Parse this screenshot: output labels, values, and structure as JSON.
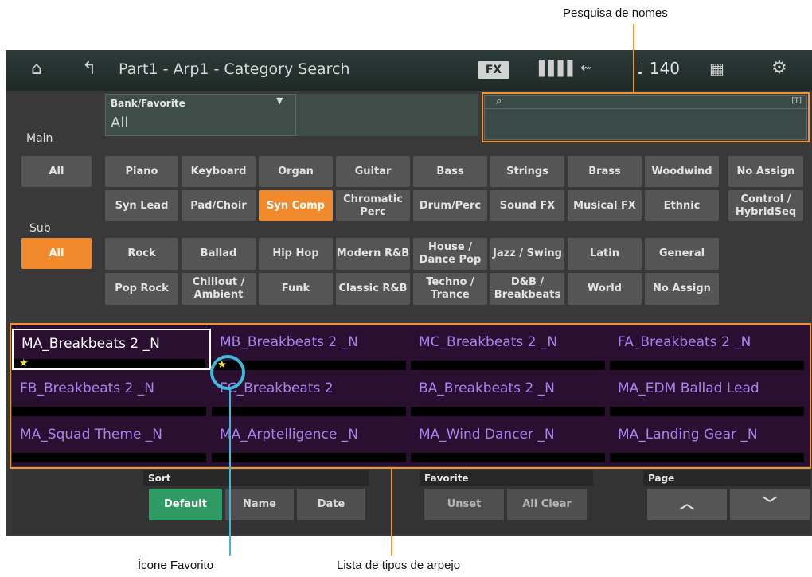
{
  "callouts": {
    "top": "Pesquisa de nomes",
    "bottom_left": "Ícone Favorito",
    "bottom_right": "Lista de tipos de arpejo"
  },
  "header": {
    "title": "Part1 - Arp1 - Category Search",
    "fx": "FX",
    "tempo": "♩ 140",
    "icons": [
      "home-icon",
      "up-arrow-icon",
      "keyboard-icon",
      "usb-icon",
      "grid-icon",
      "gear-icon"
    ]
  },
  "bank": {
    "label": "Bank/Favorite",
    "value": "All"
  },
  "search": {
    "placeholder": "",
    "tag": "[T]"
  },
  "main": {
    "label": "Main",
    "all": "All",
    "row1": [
      "Piano",
      "Keyboard",
      "Organ",
      "Guitar",
      "Bass",
      "Strings",
      "Brass",
      "Woodwind",
      "No Assign"
    ],
    "row2": [
      "Syn Lead",
      "Pad/Choir",
      "Syn Comp",
      "Chromatic Perc",
      "Drum/Perc",
      "Sound FX",
      "Musical FX",
      "Ethnic",
      "Control / HybridSeq"
    ],
    "selected": "Syn Comp"
  },
  "sub": {
    "label": "Sub",
    "all": "All",
    "row1": [
      "Rock",
      "Ballad",
      "Hip Hop",
      "Modern R&B",
      "House / Dance Pop",
      "Jazz / Swing",
      "Latin",
      "General"
    ],
    "row2": [
      "Pop Rock",
      "Chillout / Ambient",
      "Funk",
      "Classic R&B",
      "Techno / Trance",
      "D&B / Breakbeats",
      "World",
      "No Assign"
    ]
  },
  "list": [
    {
      "name": "MA_Breakbeats 2 _N",
      "favorite": true
    },
    {
      "name": "MB_Breakbeats 2 _N",
      "favorite": true
    },
    {
      "name": "MC_Breakbeats 2 _N",
      "favorite": false
    },
    {
      "name": "FA_Breakbeats 2 _N",
      "favorite": false
    },
    {
      "name": "FB_Breakbeats 2 _N",
      "favorite": false
    },
    {
      "name": "FC_Breakbeats 2",
      "favorite": false
    },
    {
      "name": "BA_Breakbeats 2 _N",
      "favorite": false
    },
    {
      "name": "MA_EDM Ballad Lead",
      "favorite": false
    },
    {
      "name": "MA_Squad Theme _N",
      "favorite": false
    },
    {
      "name": "MA_Arptelligence _N",
      "favorite": false
    },
    {
      "name": "MA_Wind Dancer _N",
      "favorite": false
    },
    {
      "name": "MA_Landing Gear _N",
      "favorite": false
    }
  ],
  "footer": {
    "sort_label": "Sort",
    "sort": [
      "Default",
      "Name",
      "Date"
    ],
    "favorite_label": "Favorite",
    "favorite": [
      "Unset",
      "All Clear"
    ],
    "page_label": "Page",
    "page_up": "︿",
    "page_down": "﹀"
  },
  "colors": {
    "accent": "#f1892d",
    "list_text": "#aa82ee",
    "list_bg": "#2a0f30",
    "callout_line_orange": "#f1932f",
    "callout_line_blue": "#3fb8dc"
  }
}
